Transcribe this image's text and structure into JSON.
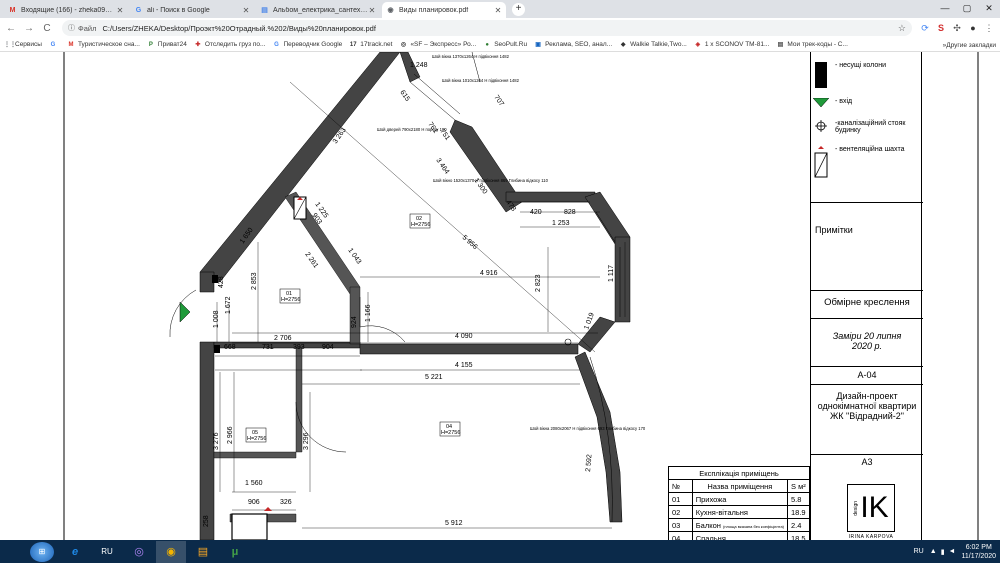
{
  "tabs": [
    {
      "title": "Входящие (166) - zheka093@gm",
      "icon": "M",
      "color": "#d93025"
    },
    {
      "title": "ali - Поиск в Google",
      "icon": "G",
      "color": "#4285f4"
    },
    {
      "title": "Альбом_електрика_сантехніка_",
      "icon": "▤",
      "color": "#4a86e8"
    },
    {
      "title": "Виды планировок.pdf",
      "icon": "◉",
      "color": "#5f6368"
    }
  ],
  "new_tab": "+",
  "window_controls": {
    "minimize": "—",
    "maximize": "▢",
    "close": "✕"
  },
  "address": {
    "label": "Файл",
    "url": "C:/Users/ZHEKA/Desktop/Проэкт%20Отрадный.%202/Виды%20планировок.pdf"
  },
  "nav": {
    "back": "←",
    "forward": "→",
    "reload": "C"
  },
  "bookmarks": [
    {
      "label": "Сервисы",
      "icon": "⋮⋮",
      "color": "#5f6368"
    },
    {
      "label": "",
      "icon": "G",
      "color": "#4285f4"
    },
    {
      "label": "Туристическое сна...",
      "icon": "M",
      "color": "#d93025"
    },
    {
      "label": "Приват24",
      "icon": "P",
      "color": "#2e7d32"
    },
    {
      "label": "Отследить груз по...",
      "icon": "✚",
      "color": "#c62828"
    },
    {
      "label": "Переводчик Google",
      "icon": "G",
      "color": "#4285f4"
    },
    {
      "label": "17track.net",
      "icon": "17",
      "color": "#333"
    },
    {
      "label": "«SF – Экспресс» Ро...",
      "icon": "◎",
      "color": "#333"
    },
    {
      "label": "SeoPult.Ru",
      "icon": "●",
      "color": "#2e7d32"
    },
    {
      "label": "Реклама, SEO, анал...",
      "icon": "▣",
      "color": "#1565c0"
    },
    {
      "label": "Walkie Talkie,Two...",
      "icon": "◆",
      "color": "#333"
    },
    {
      "label": "1 x SCONOV TM-81...",
      "icon": "◈",
      "color": "#c62828"
    },
    {
      "label": "Мои трек-коды - С...",
      "icon": "▤",
      "color": "#555"
    }
  ],
  "bookmarks_other": "Другие закладки",
  "legend": {
    "items": [
      {
        "label": "- несущі колони"
      },
      {
        "label": "- вхід"
      },
      {
        "label": "-каналізаційний стояк будинку"
      },
      {
        "label": "- вентеляційна шахта"
      }
    ],
    "notes_title": "Примітки",
    "drawing_title": "Обмірне креслення",
    "date_text": "Заміри 20 липня 2020 р.",
    "sheet_code": "A-04",
    "project_title": "Дизайн-проект однокімнатної квартири ЖК \"Відрадний-2\"",
    "format": "A3"
  },
  "explication": {
    "title": "Експлікація приміщень",
    "headers": [
      "№",
      "Назва приміщення",
      "S м²"
    ],
    "rows": [
      {
        "num": "01",
        "name": "Прихожа",
        "area": "5.8",
        "note": ""
      },
      {
        "num": "02",
        "name": "Кухня-вітальня",
        "area": "18.9",
        "note": ""
      },
      {
        "num": "03",
        "name": "Балкон",
        "area": "2.4",
        "note": "(площа вказана без коефіцієнта)"
      },
      {
        "num": "04",
        "name": "Спальня",
        "area": "18.5",
        "note": ""
      }
    ]
  },
  "logo": {
    "text": "IK",
    "subtext": "design",
    "name": "IRINA KARPOVA"
  },
  "plan_labels": {
    "dims": [
      "3 263",
      "4 916",
      "2 823",
      "5 956",
      "4 090",
      "4 155",
      "5 221",
      "5 912",
      "2 853",
      "2 706",
      "1 672",
      "1 008",
      "924",
      "1 166",
      "1 560",
      "3 276",
      "2 966",
      "3 296",
      "731",
      "393",
      "904",
      "668",
      "906",
      "326",
      "828",
      "420",
      "1 253",
      "1 117",
      "1 019",
      "1 300",
      "3 464",
      "2 261",
      "1 043",
      "1 225",
      "903",
      "761",
      "478",
      "2 592",
      "751",
      "707",
      "615",
      "1 248",
      "1 650",
      "428",
      "258"
    ],
    "rooms": [
      {
        "num": "01",
        "height": "H=2756"
      },
      {
        "num": "02",
        "height": "H=2756"
      },
      {
        "num": "04",
        "height": "H=2756"
      },
      {
        "num": "05",
        "height": "H=2756"
      }
    ],
    "notes": [
      "Шой вікно 1520х1370 Н підвіконня 869 Глибина відкосу 110",
      "Шой дверей 790х2180 Н порогу 190",
      "Шой вікна 2080х2067 Н підвіконня 693 Глибина відкосу 170",
      "Шой вікна 1010х1264 Н підвіконня 1482",
      "Шой вікна 1370х1264 Н підвіконня 1482"
    ]
  },
  "taskbar": {
    "items": [
      {
        "icon": "e",
        "color": "#1e88e5"
      },
      {
        "icon": "RU",
        "color": "#fff"
      },
      {
        "icon": "◎",
        "color": "#8e44ad"
      },
      {
        "icon": "◉",
        "color": "#e53935"
      },
      {
        "icon": "▤",
        "color": "#f9a825"
      },
      {
        "icon": "μ",
        "color": "#43a047"
      }
    ],
    "lang": "RU",
    "time": "6:02 PM",
    "date": "11/17/2020"
  }
}
